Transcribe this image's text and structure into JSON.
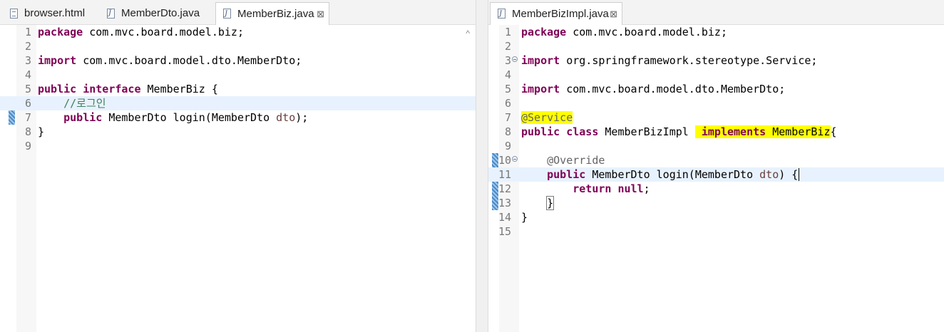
{
  "left_editor": {
    "tabs": [
      {
        "label": "browser.html",
        "icon": "html-file-icon",
        "active": false
      },
      {
        "label": "MemberDto.java",
        "icon": "java-file-icon",
        "active": false
      },
      {
        "label": "MemberBiz.java",
        "icon": "java-file-icon",
        "active": true,
        "close": "⊠"
      }
    ],
    "lines": [
      {
        "num": "1",
        "tokens": [
          [
            "kw",
            "package"
          ],
          [
            "",
            "com.mvc.board.model.biz;"
          ]
        ]
      },
      {
        "num": "2",
        "tokens": []
      },
      {
        "num": "3",
        "tokens": [
          [
            "kw",
            "import"
          ],
          [
            "",
            "com.mvc.board.model.dto.MemberDto;"
          ]
        ]
      },
      {
        "num": "4",
        "tokens": []
      },
      {
        "num": "5",
        "tokens": [
          [
            "kw",
            "public"
          ],
          [
            "kw",
            "interface"
          ],
          [
            "",
            "MemberBiz {"
          ]
        ]
      },
      {
        "num": "6",
        "tokens": [
          [
            "cm",
            "    //로그인"
          ]
        ]
      },
      {
        "num": "7",
        "tokens": [
          [
            "kw",
            "    public"
          ],
          [
            "",
            "MemberDto login(MemberDto "
          ],
          [
            "pm",
            "dto"
          ],
          [
            "",
            ");"
          ]
        ]
      },
      {
        "num": "8",
        "tokens": [
          [
            "",
            "}"
          ]
        ]
      },
      {
        "num": "9",
        "tokens": []
      }
    ],
    "scroll_up": "^"
  },
  "right_editor": {
    "tabs": [
      {
        "label": "MemberBizImpl.java",
        "icon": "java-file-icon",
        "active": true,
        "close": "⊠"
      }
    ],
    "lines": [
      {
        "num": "1",
        "tokens": [
          [
            "kw",
            "package"
          ],
          [
            "",
            "com.mvc.board.model.biz;"
          ]
        ]
      },
      {
        "num": "2",
        "tokens": []
      },
      {
        "num": "3",
        "tokens": [
          [
            "kw",
            "import"
          ],
          [
            "",
            "org.springframework.stereotype.Service;"
          ]
        ]
      },
      {
        "num": "4",
        "tokens": []
      },
      {
        "num": "5",
        "tokens": [
          [
            "kw",
            "import"
          ],
          [
            "",
            "com.mvc.board.model.dto.MemberDto;"
          ]
        ]
      },
      {
        "num": "6",
        "tokens": []
      },
      {
        "num": "7",
        "tokens": [
          [
            "an hl",
            "@Service"
          ]
        ]
      },
      {
        "num": "8",
        "tokens": [
          [
            "kw",
            "public"
          ],
          [
            "kw",
            "class"
          ],
          [
            "",
            "MemberBizImpl "
          ],
          [
            "kw hl",
            " implements"
          ],
          [
            "hl",
            " MemberBiz"
          ],
          [
            "",
            "{"
          ]
        ]
      },
      {
        "num": "9",
        "tokens": []
      },
      {
        "num": "10",
        "tokens": [
          [
            "an",
            "    @Override"
          ]
        ]
      },
      {
        "num": "11",
        "tokens": [
          [
            "kw",
            "    public"
          ],
          [
            "",
            "MemberDto login(MemberDto "
          ],
          [
            "pm",
            "dto"
          ],
          [
            "",
            ") {"
          ]
        ]
      },
      {
        "num": "12",
        "tokens": [
          [
            "kw",
            "        return"
          ],
          [
            "kw",
            "null"
          ],
          [
            "",
            ";"
          ]
        ]
      },
      {
        "num": "13",
        "tokens": [
          [
            "",
            "    }"
          ]
        ]
      },
      {
        "num": "14",
        "tokens": [
          [
            "",
            "}"
          ]
        ]
      },
      {
        "num": "15",
        "tokens": []
      }
    ]
  },
  "colors": {
    "keyword": "#7f0055",
    "comment": "#3f7f5f",
    "annotation": "#646464",
    "parameter": "#6a3e3e",
    "highlight": "#ffff00",
    "current_line": "#e8f2fe"
  }
}
